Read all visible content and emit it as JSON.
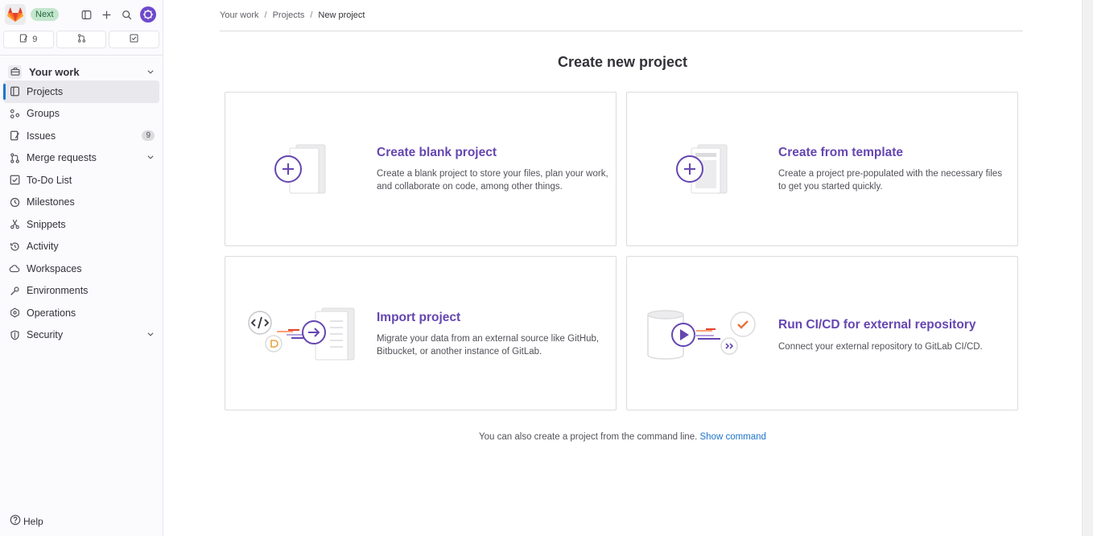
{
  "sidebar": {
    "badge": "Next",
    "counters": [
      {
        "icon": "issues-icon",
        "count": "9"
      },
      {
        "icon": "merge-request-icon",
        "count": ""
      },
      {
        "icon": "todo-icon",
        "count": ""
      }
    ],
    "context_label": "Your work",
    "nav": [
      {
        "label": "Projects",
        "icon": "project-icon",
        "active": true
      },
      {
        "label": "Groups",
        "icon": "group-icon"
      },
      {
        "label": "Issues",
        "icon": "issues-icon",
        "badge": "9"
      },
      {
        "label": "Merge requests",
        "icon": "merge-request-icon",
        "chevron": true
      },
      {
        "label": "To-Do List",
        "icon": "todo-icon"
      },
      {
        "label": "Milestones",
        "icon": "clock-icon"
      },
      {
        "label": "Snippets",
        "icon": "scissors-icon"
      },
      {
        "label": "Activity",
        "icon": "history-icon"
      },
      {
        "label": "Workspaces",
        "icon": "cloud-icon"
      },
      {
        "label": "Environments",
        "icon": "environment-icon"
      },
      {
        "label": "Operations",
        "icon": "deployments-icon"
      },
      {
        "label": "Security",
        "icon": "shield-icon",
        "chevron": true
      }
    ],
    "help_label": "Help"
  },
  "breadcrumb": {
    "items": [
      "Your work",
      "Projects",
      "New project"
    ]
  },
  "main": {
    "title": "Create new project",
    "cards": [
      {
        "title": "Create blank project",
        "description": "Create a blank project to store your files, plan your work, and collaborate on code, among other things."
      },
      {
        "title": "Create from template",
        "description": "Create a project pre-populated with the necessary files to get you started quickly."
      },
      {
        "title": "Import project",
        "description": "Migrate your data from an external source like GitHub, Bitbucket, or another instance of GitLab."
      },
      {
        "title": "Run CI/CD for external repository",
        "description": "Connect your external repository to GitLab CI/CD."
      }
    ],
    "footer_text": "You can also create a project from the command line.",
    "footer_link": "Show command"
  },
  "colors": {
    "accent_purple": "#6546b1",
    "link_blue": "#1f75cb",
    "active_bar": "#1f75cb",
    "next_badge_bg": "#c3e6cd"
  }
}
